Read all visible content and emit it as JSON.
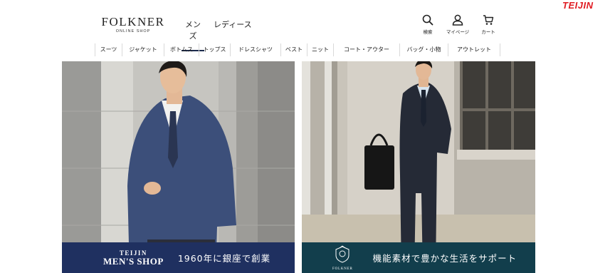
{
  "corner_logo": "TEIJIN",
  "header": {
    "brand_name": "FOLKNER",
    "brand_sub": "ONLINE SHOP",
    "tabs": [
      {
        "label": "メンズ",
        "active": true
      },
      {
        "label": "レディース",
        "active": false
      }
    ],
    "utilities": [
      {
        "label": "検索",
        "icon": "search-icon"
      },
      {
        "label": "マイページ",
        "icon": "user-icon"
      },
      {
        "label": "カート",
        "icon": "cart-icon"
      }
    ]
  },
  "category_nav": [
    "スーツ",
    "ジャケット",
    "ボトムス",
    "トップス",
    "ドレスシャツ",
    "ベスト",
    "ニット",
    "コート・アウター",
    "バッグ・小物",
    "アウトレット"
  ],
  "panels": [
    {
      "banner_logo_line1": "TEIJIN",
      "banner_logo_line2": "MEN'S SHOP",
      "banner_text": "1960年に銀座で創業",
      "banner_color": "#1f3060"
    },
    {
      "banner_logo_line1": "FOLKNER",
      "banner_text": "機能素材で豊かな生活をサポート",
      "banner_color": "#123e4c"
    }
  ],
  "colors": {
    "teijin_red": "#e01b22",
    "navy_accent": "#1d2c4d"
  }
}
